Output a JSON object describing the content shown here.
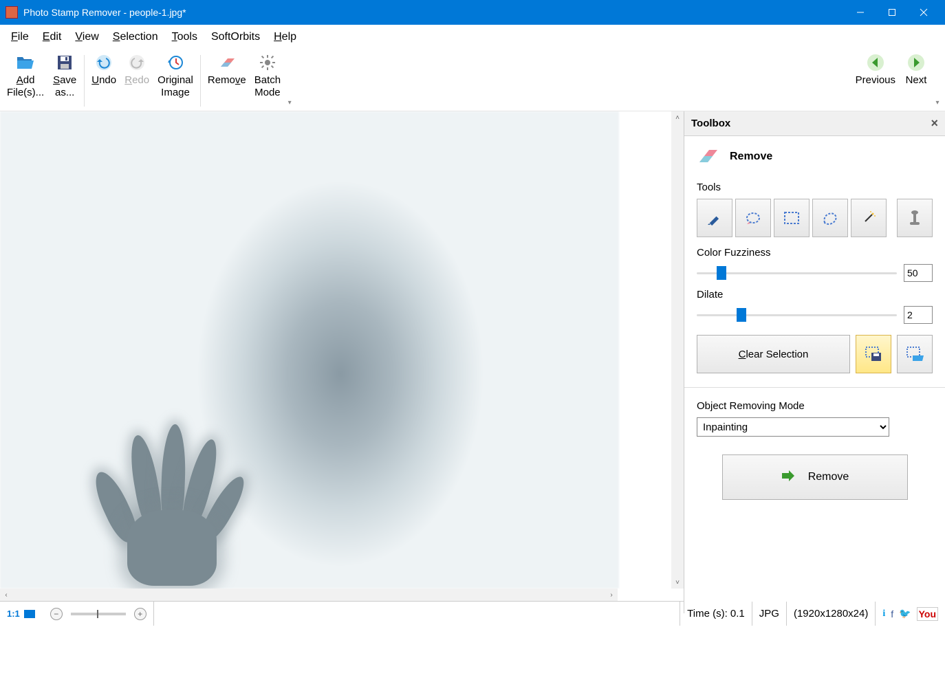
{
  "titlebar": {
    "title": "Photo Stamp Remover - people-1.jpg*"
  },
  "menu": {
    "file": "File",
    "edit": "Edit",
    "view": "View",
    "selection": "Selection",
    "tools": "Tools",
    "softorbits": "SoftOrbits",
    "help": "Help"
  },
  "toolbar": {
    "add": "Add\nFile(s)...",
    "save": "Save\nas...",
    "undo": "Undo",
    "redo": "Redo",
    "original": "Original\nImage",
    "remove": "Remove",
    "batch": "Batch\nMode",
    "previous": "Previous",
    "next": "Next"
  },
  "toolbox": {
    "panel_title": "Toolbox",
    "section_title": "Remove",
    "tools_label": "Tools",
    "color_fuzziness_label": "Color Fuzziness",
    "color_fuzziness_value": "50",
    "dilate_label": "Dilate",
    "dilate_value": "2",
    "clear_selection": "Clear Selection",
    "mode_label": "Object Removing Mode",
    "mode_value": "Inpainting",
    "remove_btn": "Remove"
  },
  "status": {
    "zoom_1_1": "1:1",
    "time": "Time (s): 0.1",
    "format": "JPG",
    "dims": "(1920x1280x24)"
  }
}
